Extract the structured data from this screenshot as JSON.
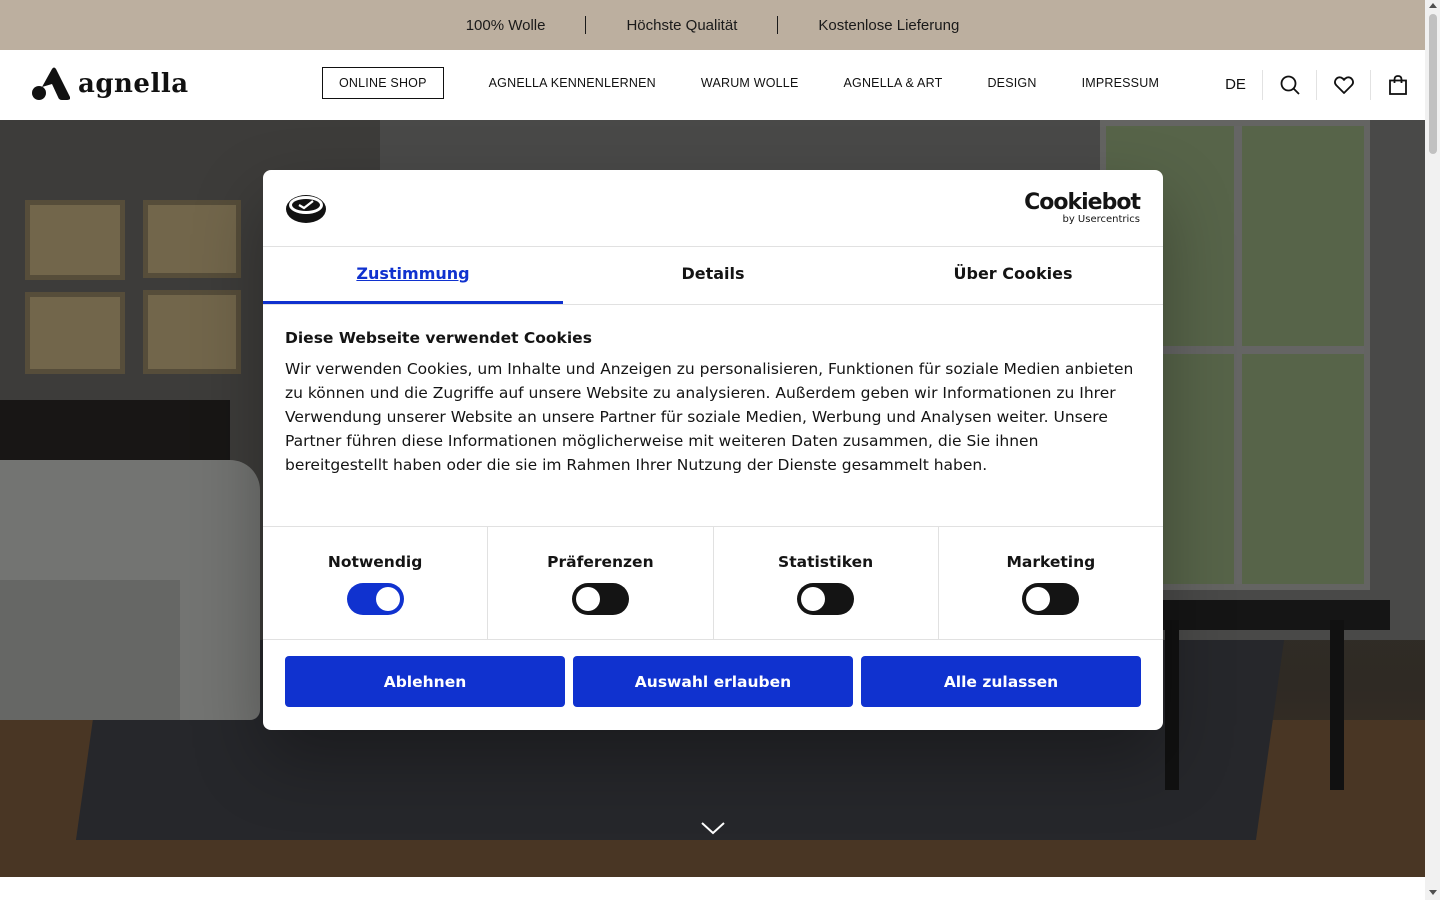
{
  "promo": {
    "items": [
      "100% Wolle",
      "Höchste Qualität",
      "Kostenlose Lieferung"
    ]
  },
  "header": {
    "logo_text": "agnella",
    "nav": [
      "ONLINE SHOP",
      "AGNELLA KENNENLERNEN",
      "WARUM WOLLE",
      "AGNELLA & ART",
      "DESIGN",
      "IMPRESSUM"
    ],
    "active_nav": "ONLINE SHOP",
    "language": "DE",
    "icons": [
      "search-icon",
      "heart-icon",
      "shopping-bag-icon"
    ]
  },
  "dialog": {
    "brand": "Cookiebot",
    "brand_sub": "by Usercentrics",
    "tabs": [
      "Zustimmung",
      "Details",
      "Über Cookies"
    ],
    "active_tab": "Zustimmung",
    "title": "Diese Webseite verwendet Cookies",
    "text": "Wir verwenden Cookies, um Inhalte und Anzeigen zu personalisieren, Funktionen für soziale Medien anbieten zu können und die Zugriffe auf unsere Website zu analysieren. Außerdem geben wir Informationen zu Ihrer Verwendung unserer Website an unsere Partner für soziale Medien, Werbung und Analysen weiter. Unsere Partner führen diese Informationen möglicherweise mit weiteren Daten zusammen, die Sie ihnen bereitgestellt haben oder die sie im Rahmen Ihrer Nutzung der Dienste gesammelt haben.",
    "toggles": [
      {
        "label": "Notwendig",
        "on": true
      },
      {
        "label": "Präferenzen",
        "on": false
      },
      {
        "label": "Statistiken",
        "on": false
      },
      {
        "label": "Marketing",
        "on": false
      }
    ],
    "buttons": [
      "Ablehnen",
      "Auswahl erlauben",
      "Alle zulassen"
    ]
  },
  "colors": {
    "promo_bg": "#bcaf9f",
    "accent": "#1032cf",
    "toggle_off": "#141414"
  }
}
